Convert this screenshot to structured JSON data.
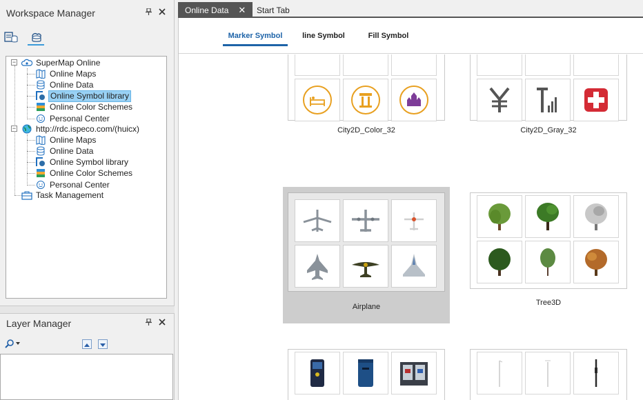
{
  "workspace": {
    "title": "Workspace Manager",
    "pin_icon": "pin-icon",
    "close_icon": "close-icon",
    "view_icons": [
      "workspace-datasource-icon",
      "online-data-icon"
    ],
    "tree": {
      "root1": {
        "label": "SuperMap Online",
        "children": [
          "Online Maps",
          "Online Data",
          "Online Symbol library",
          "Online Color Schemes",
          "Personal Center"
        ]
      },
      "root2": {
        "label": "http://rdc.ispeco.com/(huicx)",
        "children": [
          "Online Maps",
          "Online Data",
          "Online Symbol library",
          "Online Color Schemes",
          "Personal Center"
        ]
      },
      "task": "Task Management",
      "selected": "Online Symbol library"
    }
  },
  "layers": {
    "title": "Layer Manager",
    "search_icon": "search-icon",
    "up_icon": "arrow-up-icon",
    "down_icon": "arrow-down-icon"
  },
  "tabs": [
    {
      "label": "Online Data",
      "active": true,
      "closable": true
    },
    {
      "label": "Start Tab",
      "active": false,
      "closable": false
    }
  ],
  "subtabs": [
    {
      "label": "Marker Symbol",
      "active": true
    },
    {
      "label": "line Symbol",
      "active": false
    },
    {
      "label": "Fill Symbol",
      "active": false
    }
  ],
  "libraries": [
    {
      "name": "City2D_Color_32",
      "icons": [
        "bed-icon",
        "column-icon",
        "castle-icon"
      ],
      "accent": "#e8a020"
    },
    {
      "name": "City2D_Gray_32",
      "icons": [
        "yuan-icon",
        "signal-icon",
        "red-cross-icon"
      ],
      "accent": "#d42b35"
    },
    {
      "name": "Airplane",
      "icons": [
        "airliner-icon",
        "transport-plane-icon",
        "small-plane-icon",
        "fighter-jet-icon",
        "spitfire-icon",
        "delta-jet-icon"
      ],
      "selected": true
    },
    {
      "name": "Tree3D",
      "icons": [
        "willow-tree-icon",
        "oak-tree-icon",
        "bare-tree-icon",
        "round-tree-icon",
        "pine-tree-icon",
        "autumn-tree-icon"
      ]
    },
    {
      "name": "",
      "icons": [
        "blue-kiosk-icon",
        "blue-bin-icon",
        "recycle-bin-icon"
      ]
    },
    {
      "name": "",
      "icons": [
        "thin-pole-icon",
        "lamp-pole-icon",
        "black-pole-icon"
      ]
    }
  ]
}
